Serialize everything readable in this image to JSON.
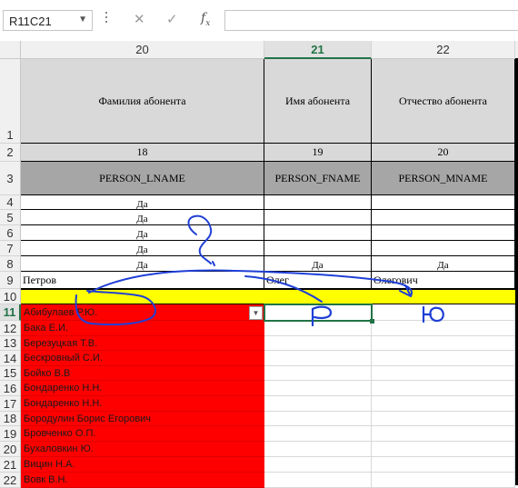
{
  "formula_bar": {
    "name_box": "R11C21",
    "cancel_icon": "close-icon",
    "enter_icon": "check-icon",
    "fx_label": "fx",
    "formula": ""
  },
  "columns": [
    {
      "label": "20",
      "selected": false
    },
    {
      "label": "21",
      "selected": true
    },
    {
      "label": "22",
      "selected": false
    }
  ],
  "rows": [
    "1",
    "2",
    "3",
    "4",
    "5",
    "6",
    "7",
    "8",
    "9",
    "10",
    "11",
    "12",
    "13",
    "14",
    "15",
    "16",
    "17",
    "18",
    "19",
    "20",
    "21",
    "22"
  ],
  "selected_row": "11",
  "header_row_1": [
    "Фамилия абонента",
    "Имя абонента",
    "Отчество абонента"
  ],
  "header_row_2": [
    "18",
    "19",
    "20"
  ],
  "header_row_3": [
    "PERSON_LNAME",
    "PERSON_FNAME",
    "PERSON_MNAME"
  ],
  "row_4": [
    "Да",
    "",
    ""
  ],
  "row_5": [
    "Да",
    "",
    ""
  ],
  "row_6": [
    "Да",
    "",
    ""
  ],
  "row_7": [
    "Да",
    "",
    ""
  ],
  "row_8": [
    "Да",
    "Да",
    "Да"
  ],
  "row_9": [
    "Петров",
    "Олег",
    "Олегович"
  ],
  "list_names": [
    "Абибулаев Р.Ю.",
    "Бака Е.И.",
    "Березуцкая Т.В.",
    "Бескровный С.И.",
    "Бойко В.В",
    "Бондаренко Н.Н.",
    "Бондаренко Н.Н.",
    "Бородулин Борис Егорович",
    "Бровченко О.П.",
    "Бухаловкин Ю.",
    "Вицин Н.А.",
    "Вовк  В.Н."
  ],
  "handwriting": [
    "Р",
    "Ю"
  ],
  "colors": {
    "accent": "#217346",
    "yellow": "#ffff00",
    "red": "#ff0000",
    "ink": "#1f3fd6"
  }
}
